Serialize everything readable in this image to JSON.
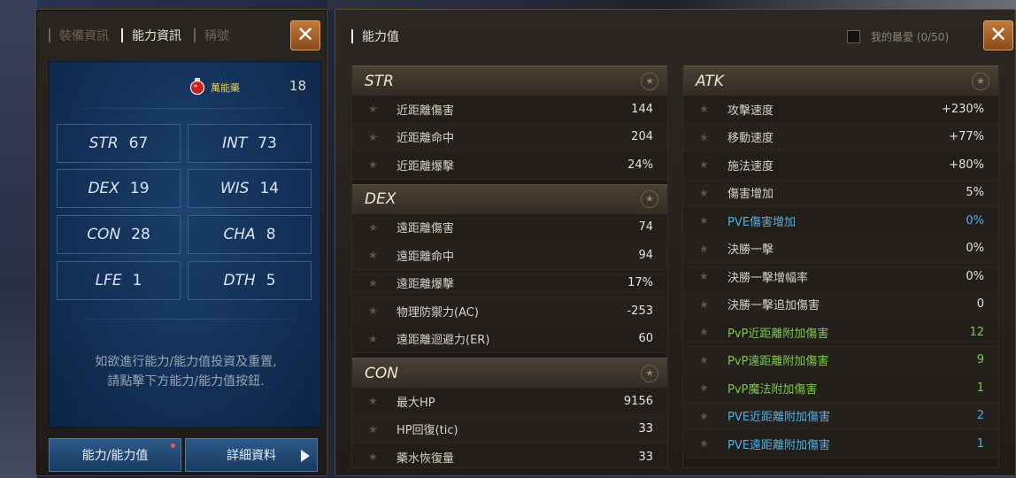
{
  "left_panel": {
    "tabs": [
      {
        "label": "裝備資訊",
        "active": false
      },
      {
        "label": "能力資訊",
        "active": true
      },
      {
        "label": "稱號",
        "active": false
      }
    ],
    "close_label": "✕",
    "potion": {
      "name": "萬能藥",
      "count": "18",
      "icon": "potion-icon"
    },
    "stats": [
      {
        "label": "STR",
        "value": "67"
      },
      {
        "label": "INT",
        "value": "73"
      },
      {
        "label": "DEX",
        "value": "19"
      },
      {
        "label": "WIS",
        "value": "14"
      },
      {
        "label": "CON",
        "value": "28"
      },
      {
        "label": "CHA",
        "value": "8"
      },
      {
        "label": "LFE",
        "value": "1"
      },
      {
        "label": "DTH",
        "value": "5"
      }
    ],
    "note_line1": "如欲進行能力/能力值投資及重置,",
    "note_line2": "請點擊下方能力/能力值按鈕.",
    "buttons": {
      "ability": "能力/能力值",
      "details": "詳細資料"
    }
  },
  "right_panel": {
    "title": "能力值",
    "favorites": "我的最愛 (0/50)",
    "close_label": "✕",
    "columns": [
      [
        {
          "title": "STR",
          "rows": [
            {
              "name": "近距離傷害",
              "value": "144"
            },
            {
              "name": "近距離命中",
              "value": "204"
            },
            {
              "name": "近距離爆擊",
              "value": "24%"
            }
          ]
        },
        {
          "title": "DEX",
          "rows": [
            {
              "name": "遠距離傷害",
              "value": "74"
            },
            {
              "name": "遠距離命中",
              "value": "94"
            },
            {
              "name": "遠距離爆擊",
              "value": "17%"
            },
            {
              "name": "物理防禦力(AC)",
              "value": "-253"
            },
            {
              "name": "遠距離迴避力(ER)",
              "value": "60"
            }
          ]
        },
        {
          "title": "CON",
          "rows": [
            {
              "name": "最大HP",
              "value": "9156"
            },
            {
              "name": "HP回復(tic)",
              "value": "33"
            },
            {
              "name": "藥水恢復量",
              "value": "33"
            }
          ]
        }
      ],
      [
        {
          "title": "ATK",
          "rows": [
            {
              "name": "攻擊速度",
              "value": "+230%"
            },
            {
              "name": "移動速度",
              "value": "+77%"
            },
            {
              "name": "施法速度",
              "value": "+80%"
            },
            {
              "name": "傷害增加",
              "value": "5%"
            },
            {
              "name": "PVE傷害增加",
              "value": "0%",
              "color": "b"
            },
            {
              "name": "決勝一擊",
              "value": "0%"
            },
            {
              "name": "決勝一擊增幅率",
              "value": "0%"
            },
            {
              "name": "決勝一擊追加傷害",
              "value": "0"
            },
            {
              "name": "PvP近距離附加傷害",
              "value": "12",
              "color": "g"
            },
            {
              "name": "PvP遠距離附加傷害",
              "value": "9",
              "color": "g"
            },
            {
              "name": "PvP魔法附加傷害",
              "value": "1",
              "color": "g"
            },
            {
              "name": "PVE近距離附加傷害",
              "value": "2",
              "color": "b"
            },
            {
              "name": "PVE遠距離附加傷害",
              "value": "1",
              "color": "b"
            }
          ]
        }
      ]
    ]
  },
  "colors": {
    "accent_orange": "#c07a3a",
    "panel_blue": "#133158",
    "green_text": "#7ec850",
    "blue_text": "#4eb0e8"
  }
}
